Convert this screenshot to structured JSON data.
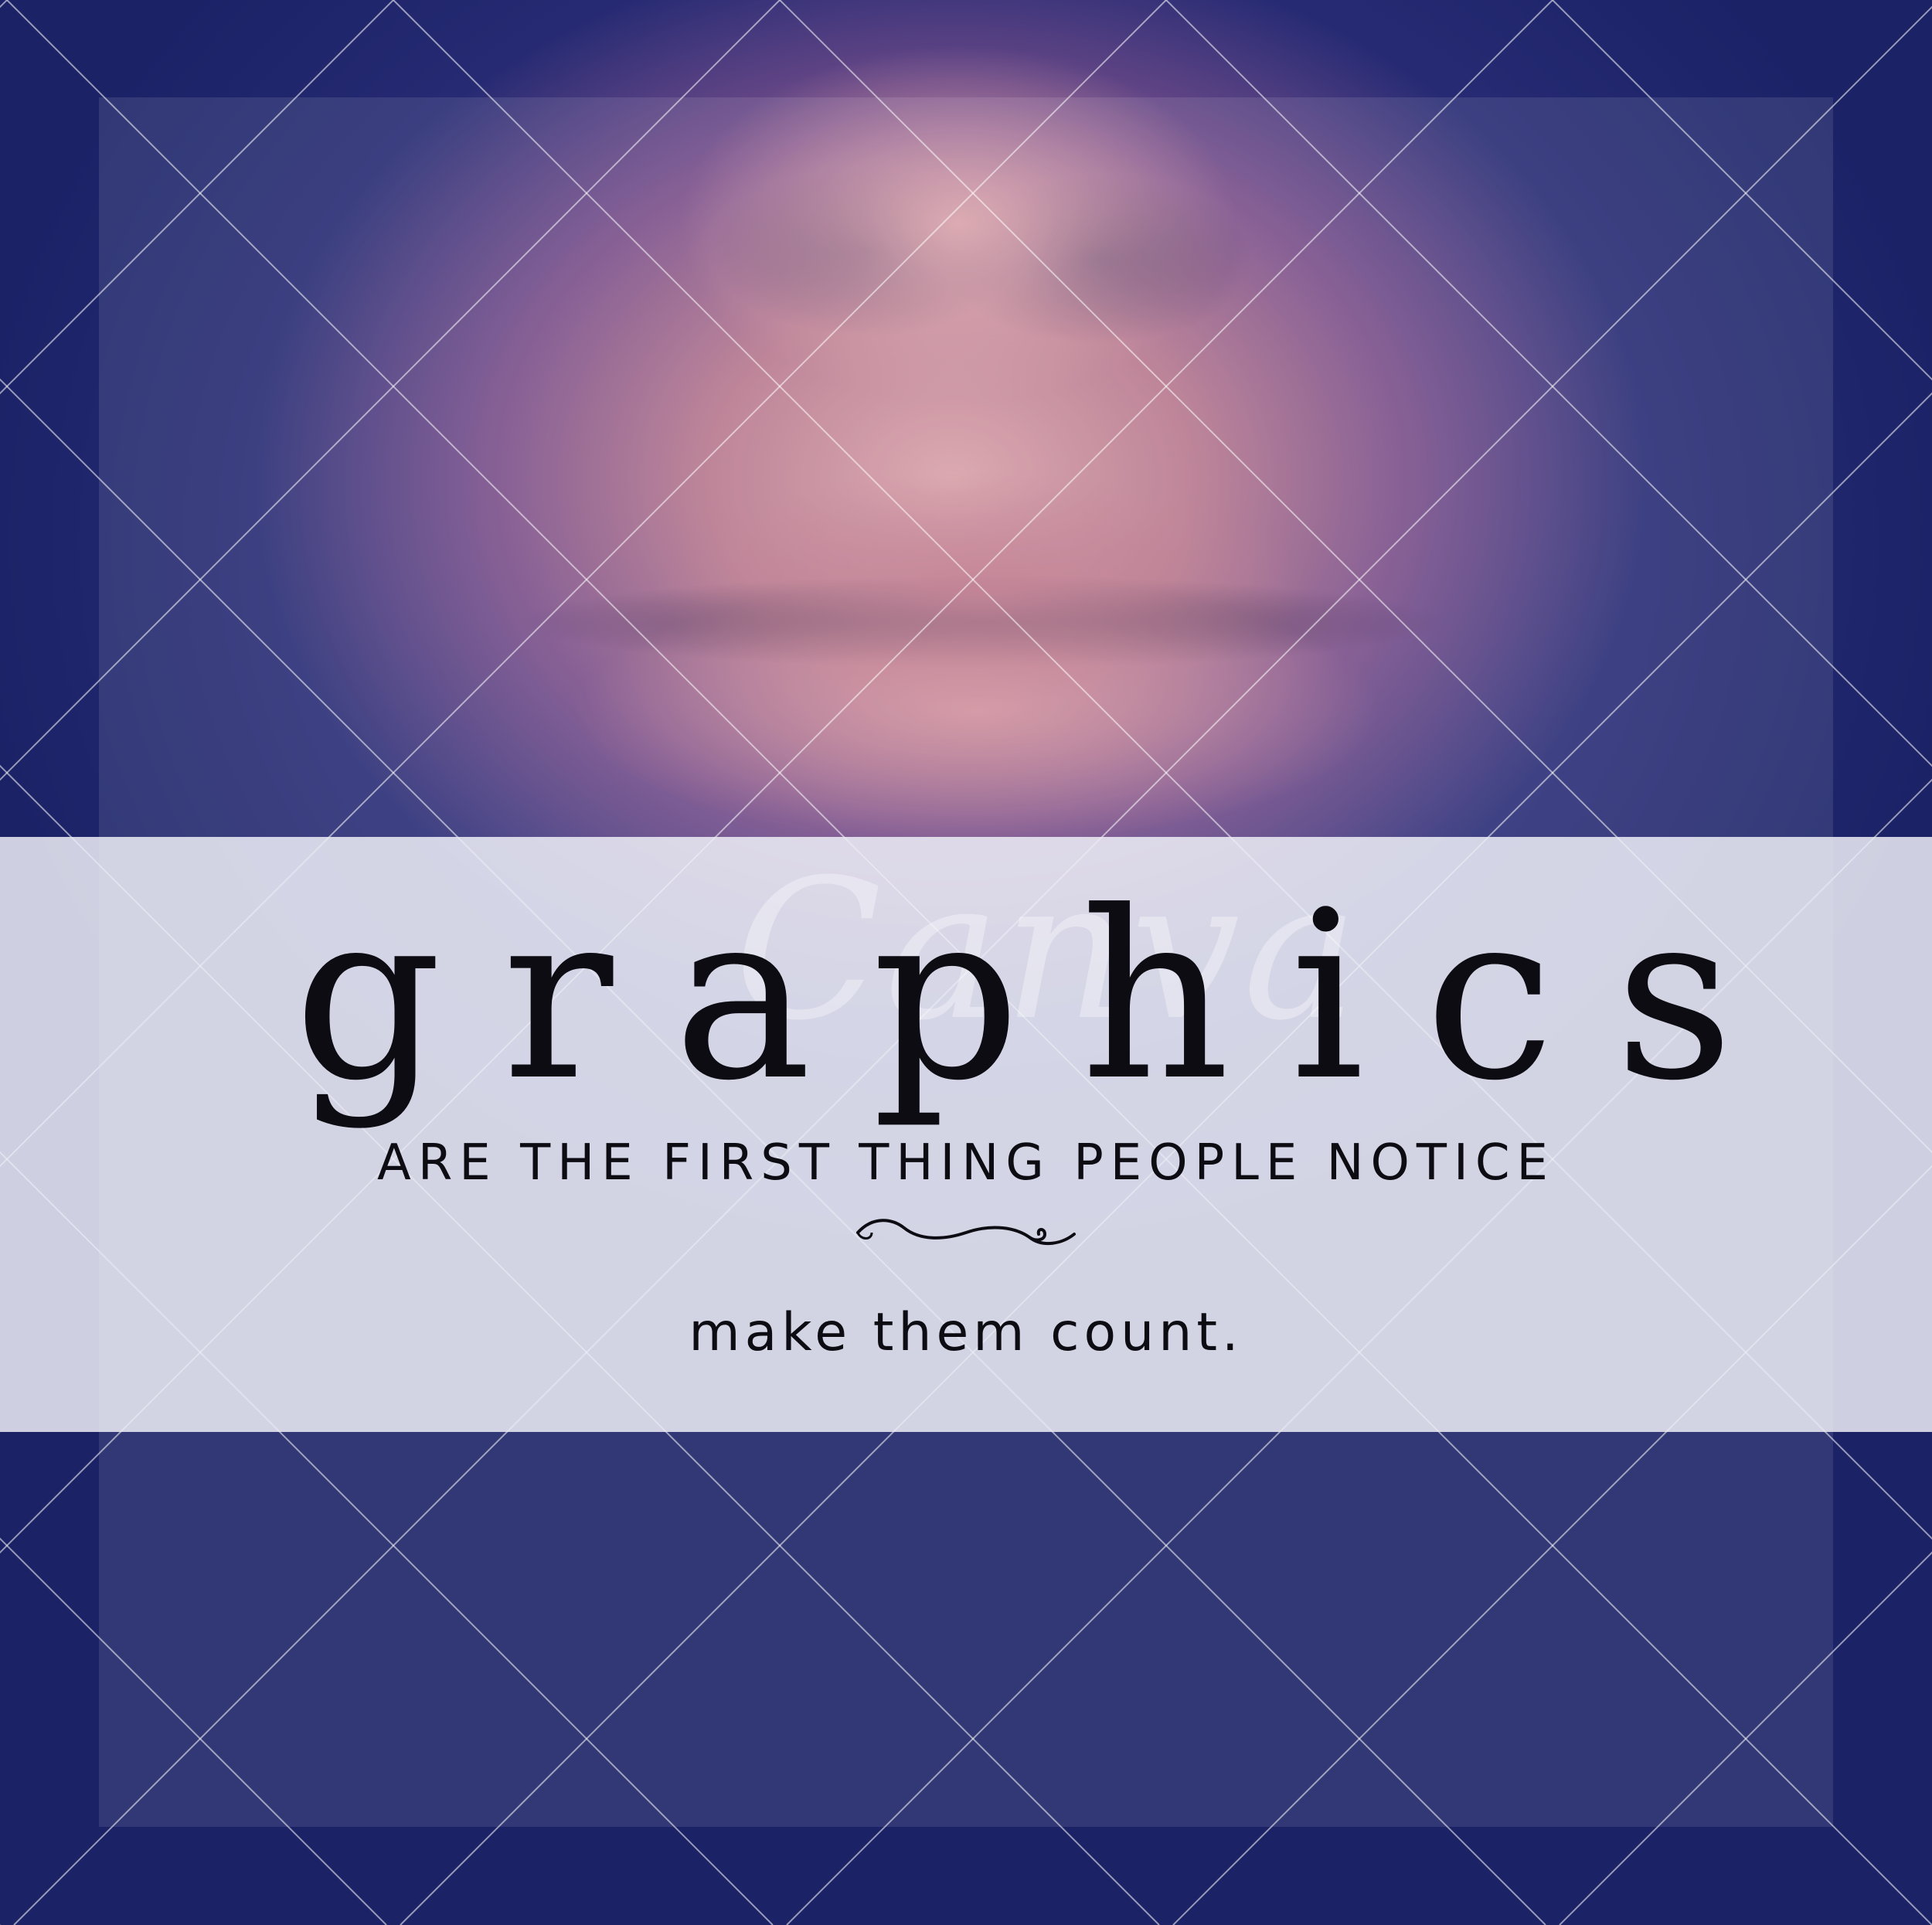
{
  "poster": {
    "headline": "graphics",
    "subhead": "ARE THE FIRST THING PEOPLE NOTICE",
    "tagline": "make them count.",
    "watermark": "Canva"
  },
  "colors": {
    "background": "#1b2266",
    "band": "#eceef6",
    "text": "#0c0c12",
    "lattice": "#ffffff"
  }
}
